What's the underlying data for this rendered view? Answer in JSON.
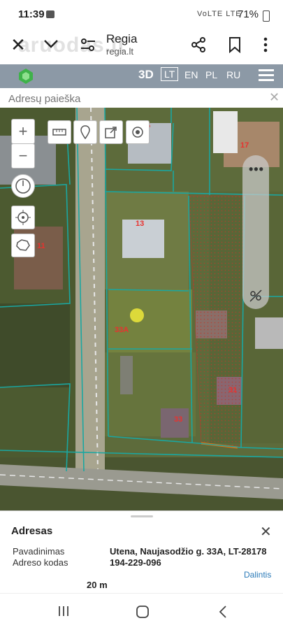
{
  "status": {
    "time": "11:39",
    "battery": "71%",
    "network": "VoLTE LTE"
  },
  "browser": {
    "title": "Regia",
    "url": "regia.lt",
    "watermark": "aruodas.lt"
  },
  "toolbar": {
    "btn3d": "3D",
    "languages": [
      "LT",
      "EN",
      "PL",
      "RU"
    ],
    "selected_language": "LT"
  },
  "search": {
    "placeholder": "Adresų paieška"
  },
  "map": {
    "labels": [
      "5",
      "17",
      "13",
      "11",
      "33A",
      "31",
      "33"
    ]
  },
  "info": {
    "title": "Adresas",
    "fields": [
      {
        "label": "Pavadinimas",
        "value": "Utena, Naujasodžio g. 33A, LT-28178"
      },
      {
        "label": "Adreso kodas",
        "value": "194-229-096"
      }
    ],
    "share": "Dalintis",
    "scale": "20 m"
  },
  "colors": {
    "toolbar": "#8c99a6",
    "parcel_line": "#1aa7a1",
    "label": "#e8322f",
    "link": "#2a7ab8"
  }
}
